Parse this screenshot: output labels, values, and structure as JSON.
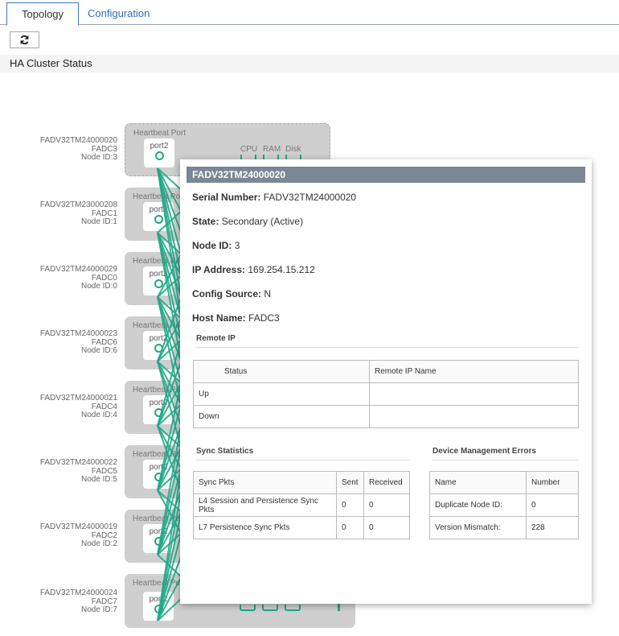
{
  "tabs": [
    {
      "label": "Topology"
    },
    {
      "label": "Configuration"
    }
  ],
  "refresh_icon": "refresh-icon",
  "section_title": "HA Cluster Status",
  "accent": "#20a887",
  "nodes": [
    {
      "serial": "FADV32TM24000020",
      "host": "FADC3",
      "node_id": "Node ID:3",
      "hb": "Heartbeat Port",
      "port": "port2",
      "cpu": "CPU",
      "ram": "RAM",
      "disk": "Disk"
    },
    {
      "serial": "FADV32TM23000208",
      "host": "FADC1",
      "node_id": "Node ID:1",
      "hb": "Heartbeat Port",
      "port": "port2"
    },
    {
      "serial": "FADV32TM24000029",
      "host": "FADC0",
      "node_id": "Node ID:0",
      "hb": "Heartbeat Port",
      "port": "port2"
    },
    {
      "serial": "FADV32TM24000023",
      "host": "FADC6",
      "node_id": "Node ID:6",
      "hb": "Heartbeat Port",
      "port": "port2"
    },
    {
      "serial": "FADV32TM24000021",
      "host": "FADC4",
      "node_id": "Node ID:4",
      "hb": "Heartbeat Port",
      "port": "port2"
    },
    {
      "serial": "FADV32TM24000022",
      "host": "FADC5",
      "node_id": "Node ID:5",
      "hb": "Heartbeat Port",
      "port": "port2"
    },
    {
      "serial": "FADV32TM24000019",
      "host": "FADC2",
      "node_id": "Node ID:2",
      "hb": "Heartbeat Port",
      "port": "port2"
    },
    {
      "serial": "FADV32TM24000024",
      "host": "FADC7",
      "node_id": "Node ID:7",
      "hb": "Heartbeat Port",
      "port": "port2"
    }
  ],
  "popup": {
    "title": "FADV32TM24000020",
    "fields": [
      {
        "label": "Serial Number:",
        "value": "FADV32TM24000020"
      },
      {
        "label": "State:",
        "value": "Secondary (Active)"
      },
      {
        "label": "Node ID:",
        "value": "3"
      },
      {
        "label": "IP Address:",
        "value": "169.254.15.212"
      },
      {
        "label": "Config Source:",
        "value": "N"
      },
      {
        "label": "Host Name:",
        "value": "FADC3"
      }
    ],
    "remote_ip": {
      "title": "Remote IP",
      "headers": [
        "Status",
        "Remote IP Name"
      ],
      "rows": [
        [
          "Up",
          ""
        ],
        [
          "Down",
          ""
        ]
      ]
    },
    "sync": {
      "title": "Sync Statistics",
      "headers": [
        "Sync Pkts",
        "Sent",
        "Received"
      ],
      "rows": [
        [
          "L4 Session and Persistence Sync Pkts",
          "0",
          "0"
        ],
        [
          "L7 Persistence Sync Pkts",
          "0",
          "0"
        ]
      ]
    },
    "errors": {
      "title": "Device Management Errors",
      "headers": [
        "Name",
        "Number"
      ],
      "rows": [
        [
          "Duplicate Node ID:",
          "0"
        ],
        [
          "Version Mismatch:",
          "228"
        ]
      ]
    }
  }
}
